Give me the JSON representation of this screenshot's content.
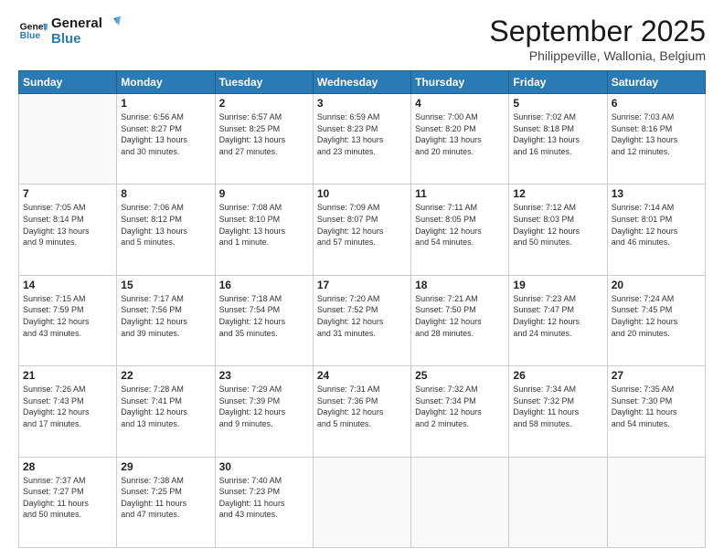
{
  "logo": {
    "line1": "General",
    "line2": "Blue"
  },
  "title": "September 2025",
  "subtitle": "Philippeville, Wallonia, Belgium",
  "days_of_week": [
    "Sunday",
    "Monday",
    "Tuesday",
    "Wednesday",
    "Thursday",
    "Friday",
    "Saturday"
  ],
  "weeks": [
    [
      {
        "day": "",
        "info": ""
      },
      {
        "day": "1",
        "info": "Sunrise: 6:56 AM\nSunset: 8:27 PM\nDaylight: 13 hours\nand 30 minutes."
      },
      {
        "day": "2",
        "info": "Sunrise: 6:57 AM\nSunset: 8:25 PM\nDaylight: 13 hours\nand 27 minutes."
      },
      {
        "day": "3",
        "info": "Sunrise: 6:59 AM\nSunset: 8:23 PM\nDaylight: 13 hours\nand 23 minutes."
      },
      {
        "day": "4",
        "info": "Sunrise: 7:00 AM\nSunset: 8:20 PM\nDaylight: 13 hours\nand 20 minutes."
      },
      {
        "day": "5",
        "info": "Sunrise: 7:02 AM\nSunset: 8:18 PM\nDaylight: 13 hours\nand 16 minutes."
      },
      {
        "day": "6",
        "info": "Sunrise: 7:03 AM\nSunset: 8:16 PM\nDaylight: 13 hours\nand 12 minutes."
      }
    ],
    [
      {
        "day": "7",
        "info": "Sunrise: 7:05 AM\nSunset: 8:14 PM\nDaylight: 13 hours\nand 9 minutes."
      },
      {
        "day": "8",
        "info": "Sunrise: 7:06 AM\nSunset: 8:12 PM\nDaylight: 13 hours\nand 5 minutes."
      },
      {
        "day": "9",
        "info": "Sunrise: 7:08 AM\nSunset: 8:10 PM\nDaylight: 13 hours\nand 1 minute."
      },
      {
        "day": "10",
        "info": "Sunrise: 7:09 AM\nSunset: 8:07 PM\nDaylight: 12 hours\nand 57 minutes."
      },
      {
        "day": "11",
        "info": "Sunrise: 7:11 AM\nSunset: 8:05 PM\nDaylight: 12 hours\nand 54 minutes."
      },
      {
        "day": "12",
        "info": "Sunrise: 7:12 AM\nSunset: 8:03 PM\nDaylight: 12 hours\nand 50 minutes."
      },
      {
        "day": "13",
        "info": "Sunrise: 7:14 AM\nSunset: 8:01 PM\nDaylight: 12 hours\nand 46 minutes."
      }
    ],
    [
      {
        "day": "14",
        "info": "Sunrise: 7:15 AM\nSunset: 7:59 PM\nDaylight: 12 hours\nand 43 minutes."
      },
      {
        "day": "15",
        "info": "Sunrise: 7:17 AM\nSunset: 7:56 PM\nDaylight: 12 hours\nand 39 minutes."
      },
      {
        "day": "16",
        "info": "Sunrise: 7:18 AM\nSunset: 7:54 PM\nDaylight: 12 hours\nand 35 minutes."
      },
      {
        "day": "17",
        "info": "Sunrise: 7:20 AM\nSunset: 7:52 PM\nDaylight: 12 hours\nand 31 minutes."
      },
      {
        "day": "18",
        "info": "Sunrise: 7:21 AM\nSunset: 7:50 PM\nDaylight: 12 hours\nand 28 minutes."
      },
      {
        "day": "19",
        "info": "Sunrise: 7:23 AM\nSunset: 7:47 PM\nDaylight: 12 hours\nand 24 minutes."
      },
      {
        "day": "20",
        "info": "Sunrise: 7:24 AM\nSunset: 7:45 PM\nDaylight: 12 hours\nand 20 minutes."
      }
    ],
    [
      {
        "day": "21",
        "info": "Sunrise: 7:26 AM\nSunset: 7:43 PM\nDaylight: 12 hours\nand 17 minutes."
      },
      {
        "day": "22",
        "info": "Sunrise: 7:28 AM\nSunset: 7:41 PM\nDaylight: 12 hours\nand 13 minutes."
      },
      {
        "day": "23",
        "info": "Sunrise: 7:29 AM\nSunset: 7:39 PM\nDaylight: 12 hours\nand 9 minutes."
      },
      {
        "day": "24",
        "info": "Sunrise: 7:31 AM\nSunset: 7:36 PM\nDaylight: 12 hours\nand 5 minutes."
      },
      {
        "day": "25",
        "info": "Sunrise: 7:32 AM\nSunset: 7:34 PM\nDaylight: 12 hours\nand 2 minutes."
      },
      {
        "day": "26",
        "info": "Sunrise: 7:34 AM\nSunset: 7:32 PM\nDaylight: 11 hours\nand 58 minutes."
      },
      {
        "day": "27",
        "info": "Sunrise: 7:35 AM\nSunset: 7:30 PM\nDaylight: 11 hours\nand 54 minutes."
      }
    ],
    [
      {
        "day": "28",
        "info": "Sunrise: 7:37 AM\nSunset: 7:27 PM\nDaylight: 11 hours\nand 50 minutes."
      },
      {
        "day": "29",
        "info": "Sunrise: 7:38 AM\nSunset: 7:25 PM\nDaylight: 11 hours\nand 47 minutes."
      },
      {
        "day": "30",
        "info": "Sunrise: 7:40 AM\nSunset: 7:23 PM\nDaylight: 11 hours\nand 43 minutes."
      },
      {
        "day": "",
        "info": ""
      },
      {
        "day": "",
        "info": ""
      },
      {
        "day": "",
        "info": ""
      },
      {
        "day": "",
        "info": ""
      }
    ]
  ]
}
